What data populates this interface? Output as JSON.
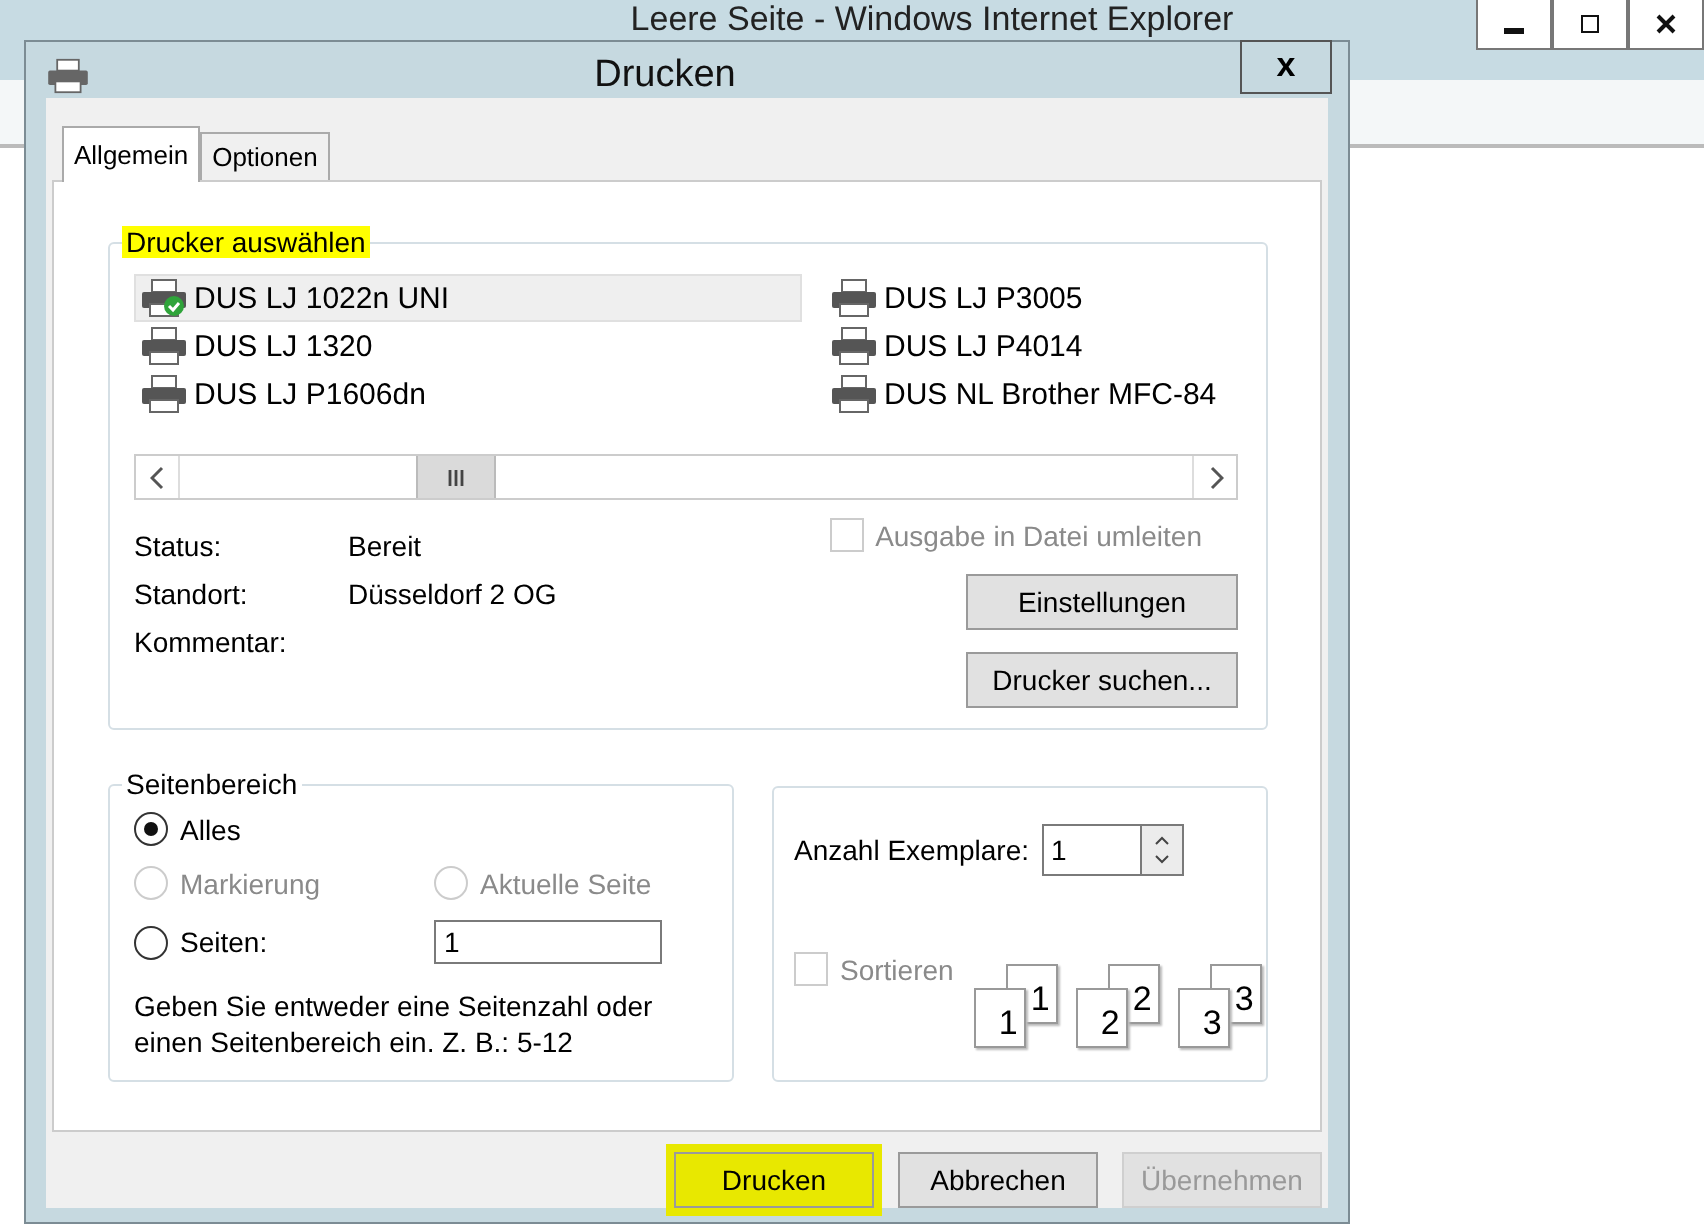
{
  "background_window": {
    "title": "Leere Seite - Windows Internet Explorer"
  },
  "dialog": {
    "title": "Drucken",
    "close": "x"
  },
  "tabs": [
    {
      "label": "Allgemein",
      "selected": true
    },
    {
      "label": "Optionen",
      "selected": false
    }
  ],
  "printer_group": {
    "legend": "Drucker auswählen",
    "highlighted": true,
    "printers": [
      {
        "name": "DUS LJ 1022n UNI",
        "selected": true,
        "default": true
      },
      {
        "name": "DUS LJ 1320",
        "selected": false,
        "default": false
      },
      {
        "name": "DUS LJ P1606dn",
        "selected": false,
        "default": false
      },
      {
        "name": "DUS LJ P3005",
        "selected": false,
        "default": false
      },
      {
        "name": "DUS LJ P4014",
        "selected": false,
        "default": false
      },
      {
        "name": "DUS NL Brother MFC-84",
        "selected": false,
        "default": false
      }
    ],
    "status": [
      {
        "label": "Status:",
        "value": "Bereit"
      },
      {
        "label": "Standort:",
        "value": "Düsseldorf 2 OG"
      },
      {
        "label": "Kommentar:"
      }
    ],
    "print_to_file": {
      "label": "Ausgabe in Datei umleiten",
      "checked": false,
      "disabled": true
    },
    "buttons": [
      {
        "label": "Einstellungen"
      },
      {
        "label": "Drucker suchen..."
      }
    ]
  },
  "page_range": {
    "legend": "Seitenbereich",
    "options": [
      {
        "label": "Alles",
        "selected": true,
        "disabled": false
      },
      {
        "label": "Markierung",
        "selected": false,
        "disabled": true
      },
      {
        "label": "Aktuelle Seite",
        "selected": false,
        "disabled": true
      },
      {
        "label": "Seiten:",
        "selected": false,
        "disabled": false
      }
    ],
    "pages_value": "1",
    "hint": "Geben Sie entweder eine Seitenzahl oder einen Seitenbereich ein. Z. B.: 5-12"
  },
  "copies": {
    "label": "Anzahl Exemplare:",
    "value": "1",
    "collate": {
      "label": "Sortieren",
      "checked": false,
      "disabled": true
    },
    "collate_stacks": [
      {
        "back": "1",
        "front": "1"
      },
      {
        "back": "2",
        "front": "2"
      },
      {
        "back": "3",
        "front": "3"
      }
    ]
  },
  "buttons": [
    {
      "label": "Drucken",
      "highlighted": true,
      "disabled": false
    },
    {
      "label": "Abbrechen",
      "highlighted": false,
      "disabled": false
    },
    {
      "label": "Übernehmen",
      "highlighted": false,
      "disabled": true
    }
  ]
}
